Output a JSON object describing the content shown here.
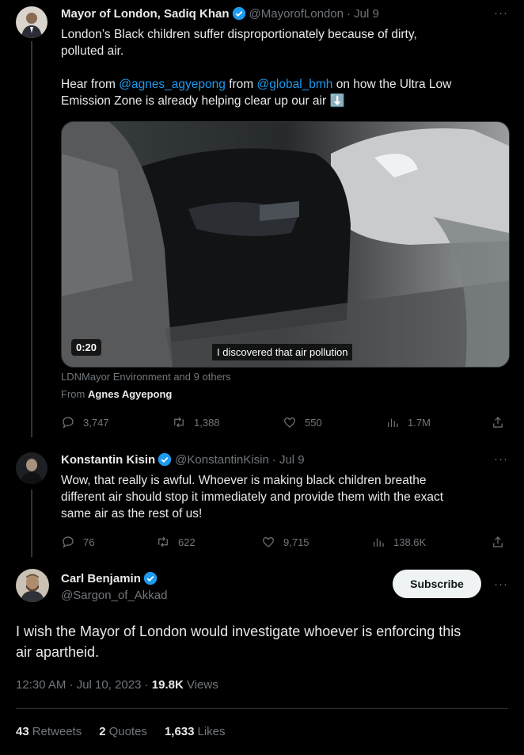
{
  "tweet1": {
    "name": "Mayor of London, Sadiq Khan",
    "handle": "@MayorofLondon",
    "time": "· Jul 9",
    "line1": "London’s Black children suffer disproportionately because of dirty,",
    "line2": "polluted air.",
    "line3_pre": "Hear from ",
    "mention1": "@agnes_agyepong",
    "line3_mid": " from ",
    "mention2": "@global_bmh",
    "line3_post": " on how the Ultra Low",
    "line4": "Emission Zone is already helping clear up our air ⬇️",
    "video_duration": "0:20",
    "video_caption": "I discovered that air pollution",
    "tagged": "LDNMayor Environment and 9 others",
    "from_label": "From ",
    "from_name": "Agnes Agyepong",
    "replies": "3,747",
    "retweets": "1,388",
    "likes": "550",
    "views": "1.7M"
  },
  "tweet2": {
    "name": "Konstantin Kisin",
    "handle": "@KonstantinKisin",
    "time": "· Jul 9",
    "line1": "Wow, that really is awful. Whoever is making black children breathe",
    "line2": "different air should stop it immediately and provide them with the exact",
    "line3": "same air as the rest of us!",
    "replies": "76",
    "retweets": "622",
    "likes": "9,715",
    "views": "138.6K"
  },
  "main": {
    "name": "Carl Benjamin",
    "handle": "@Sargon_of_Akkad",
    "subscribe_label": "Subscribe",
    "line1": "I wish the Mayor of London would investigate whoever is enforcing this",
    "line2": "air apartheid.",
    "timestamp": "12:30 AM · Jul 10, 2023 · ",
    "views_count": "19.8K",
    "views_label": " Views",
    "retweets_count": "43",
    "retweets_label": "Retweets",
    "quotes_count": "2",
    "quotes_label": "Quotes",
    "likes_count": "1,633",
    "likes_label": "Likes"
  },
  "more_label": "···",
  "colors": {
    "background": "#000000",
    "accent": "#1d9bf0",
    "muted": "#71767b",
    "text": "#e7e9ea"
  },
  "icons": [
    "verified-badge-icon",
    "reply-icon",
    "retweet-icon",
    "like-icon",
    "views-icon",
    "share-icon",
    "more-icon"
  ]
}
